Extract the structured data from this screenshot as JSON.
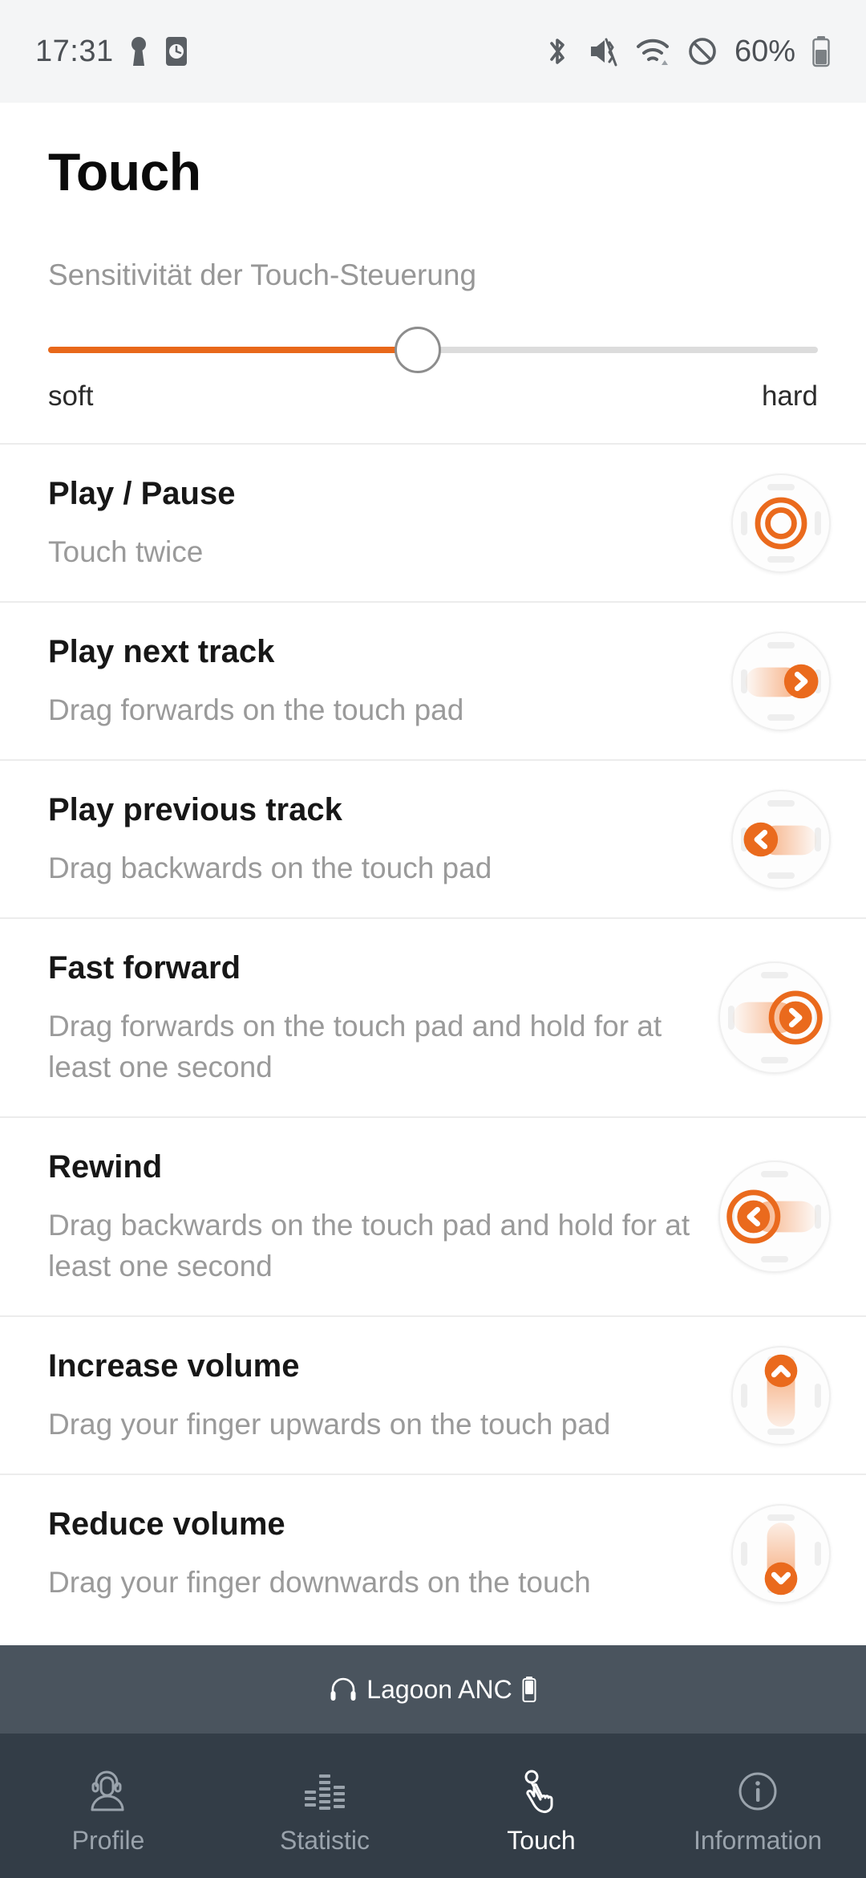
{
  "status_bar": {
    "time": "17:31",
    "battery_percent": "60%",
    "left_icons": [
      "keyhole-icon",
      "alarm-device-icon"
    ],
    "right_icons": [
      "bluetooth-icon",
      "vibrate-off-icon",
      "wifi-icon",
      "do-not-disturb-icon"
    ]
  },
  "header": {
    "title": "Touch",
    "subtitle": "Sensitivität der Touch-Steuerung"
  },
  "sensitivity_slider": {
    "value_percent": 48,
    "min_label": "soft",
    "max_label": "hard",
    "fill_color": "#e8681a",
    "track_color": "#dcdcdc"
  },
  "actions": [
    {
      "title": "Play / Pause",
      "description": "Touch twice",
      "icon": "touchpad-double-tap-icon"
    },
    {
      "title": "Play next track",
      "description": "Drag forwards on the touch pad",
      "icon": "touchpad-swipe-right-icon"
    },
    {
      "title": "Play previous track",
      "description": "Drag backwards on the touch pad",
      "icon": "touchpad-swipe-left-icon"
    },
    {
      "title": "Fast forward",
      "description": "Drag forwards on the touch pad and hold for at least one second",
      "icon": "touchpad-swipe-right-hold-icon"
    },
    {
      "title": "Rewind",
      "description": "Drag backwards on the touch pad and hold for at least one second",
      "icon": "touchpad-swipe-left-hold-icon"
    },
    {
      "title": "Increase volume",
      "description": "Drag your finger upwards on the touch pad",
      "icon": "touchpad-swipe-up-icon"
    },
    {
      "title": "Reduce volume",
      "description": "Drag your finger downwards on the touch",
      "icon": "touchpad-swipe-down-icon"
    }
  ],
  "device_bar": {
    "name": "Lagoon ANC",
    "headphone_icon": "headphones-icon",
    "battery_icon": "battery-icon"
  },
  "tabs": [
    {
      "label": "Profile",
      "icon": "profile-headset-icon",
      "active": false
    },
    {
      "label": "Statistic",
      "icon": "equalizer-icon",
      "active": false
    },
    {
      "label": "Touch",
      "icon": "hand-tap-icon",
      "active": true
    },
    {
      "label": "Information",
      "icon": "info-circle-icon",
      "active": false
    }
  ],
  "colors": {
    "accent": "#e8681a",
    "device_bar_bg": "#4a545e",
    "tab_bar_bg": "#333d47",
    "status_bar_bg": "#f4f5f6"
  }
}
